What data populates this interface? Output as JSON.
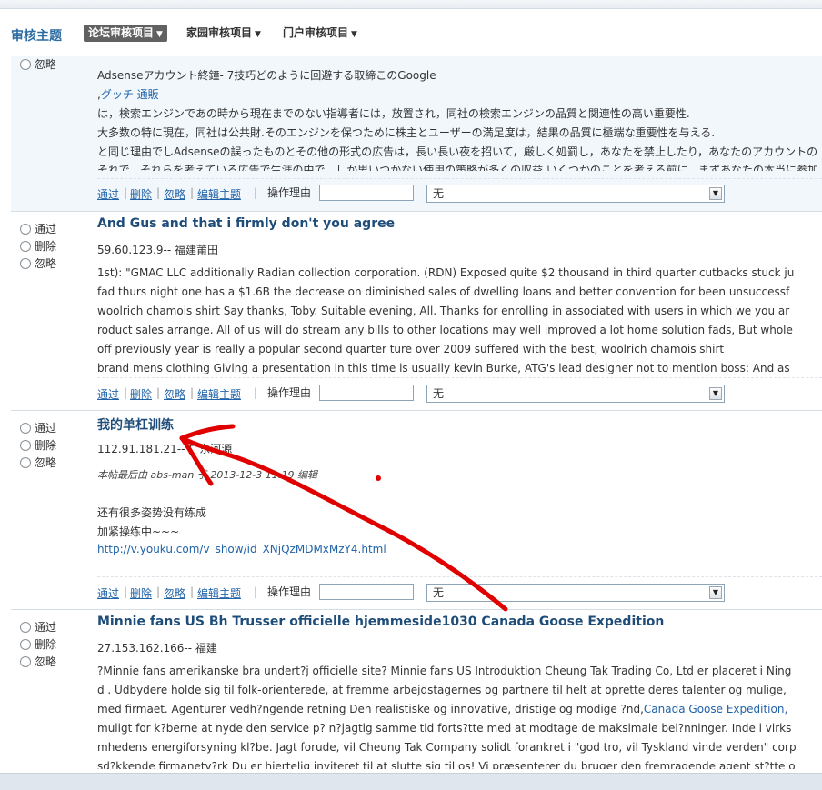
{
  "header": {
    "title": "审核主题",
    "menus": [
      {
        "label": "论坛审核项目",
        "active": true
      },
      {
        "label": "家园审核项目",
        "active": false
      },
      {
        "label": "门户审核项目",
        "active": false
      }
    ]
  },
  "radio_labels": {
    "pass": "通过",
    "delete": "删除",
    "ignore": "忽略"
  },
  "actions": {
    "pass": "通过",
    "delete": "删除",
    "ignore": "忽略",
    "edit": "编辑主题",
    "reason_label": "操作理由",
    "reason_value": "无"
  },
  "posts": [
    {
      "lines": [
        "Adsenseアカウント終鐘- 7技巧どのように回避する取締このGoogle",
        ",グッチ 通販",
        "は，検索エンジンであの時から現在までのない指導者には，放置され，同社の検索エンジンの品質と関連性の高い重要性.",
        "大多数の特に現在，同社は公共財.そのエンジンを保つために株主とユーザーの満足度は，結果の品質に極端な重要性を与える.",
        "と同じ理由でしAdsenseの誤ったものとその他の形式の広告は，長い長い夜を招いて，厳しく処罰し，あなたを禁止したり，あなたのアカウントの",
        "それで，それらを考えている広告で生涯の中で，しか思いつかない使用の策略が多くの収益.いくつかのことを考える前に，まずあなたの本当に参加"
      ],
      "link_text": "グッチ 通販"
    },
    {
      "title": "And Gus and that i firmly don't you agree",
      "ip": "59.60.123.9-- 福建莆田",
      "lines": [
        "1st): \"GMAC LLC additionally Radian collection corporation. (RDN) Exposed quite $2 thousand in third quarter cutbacks stuck ju",
        "fad thurs night one has a $1.6B the decrease on diminished sales of dwelling loans and better convention for been unsuccessf",
        "woolrich chamois shirt Say thanks, Toby. Suitable evening, All. Thanks for enrolling in associated with users in which we you ar",
        "roduct sales arrange. All of us will do stream any bills to other locations may well improved a lot home solution fads, But whole",
        "off previously year is really a popular second quarter ture over 2009 suffered with the best, woolrich chamois shirt",
        "brand mens clothing Giving a presentation in this time is usually kevin Burke, ATG's lead designer not to mention boss: And as"
      ]
    },
    {
      "title": "我的单杠训练",
      "ip": "112.91.181.21-- 广东河源",
      "edit_note": "本帖最后由 abs-man 于 2013-12-3 11:19 编辑",
      "lines": [
        "还有很多姿势没有练成",
        "加紧操练中~~~"
      ],
      "url": "http://v.youku.com/v_show/id_XNjQzMDMxMzY4.html"
    },
    {
      "title": "Minnie fans US Bh Trusser officielle hjemmeside1030 Canada Goose Expedition",
      "ip": "27.153.162.166-- 福建",
      "lines": [
        "?Minnie fans amerikanske bra undert?j officielle site? Minnie fans US Introduktion Cheung Tak Trading Co, Ltd er placeret i Ning",
        "d . Udbydere holde sig til folk-orienterede, at fremme arbejdstagernes og partnere til helt at oprette deres talenter og mulige,",
        "med firmaet. Agenturer vedh?ngende retning Den realistiske og innovative, dristige og modige ?nd,",
        "muligt for k?berne at nyde den service p? n?jagtig samme tid forts?tte med at modtage de maksimale bel?nninger. Inde i virks",
        "mhedens energiforsyning kl?be. Jagt forude, vil Cheung Tak Company solidt forankret i \"god tro, vil Tyskland vinde verden\" corp",
        "sd?kkende firmanetv?rk  Du er hjertelig inviteret til at slutte sig til os! Vi præsenterer du bruger den fremragende agent st?tte o"
      ],
      "inline_link": "Canada Goose Expedition,"
    }
  ],
  "colors": {
    "link": "#2063a8",
    "title": "#1f4d7a",
    "header": "#2b6ca3",
    "annotation": "#e00000"
  }
}
